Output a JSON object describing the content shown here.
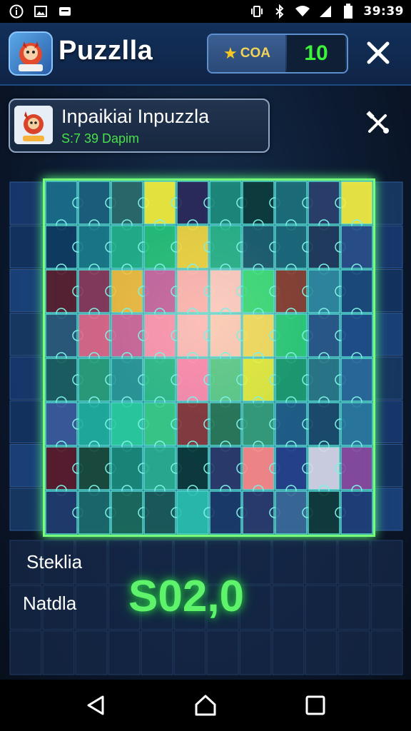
{
  "status_bar": {
    "time": "39:39",
    "left_icons": [
      "info-icon",
      "image-icon",
      "message-icon"
    ],
    "right_icons": [
      "vibrate-icon",
      "bluetooth-icon",
      "wifi-icon",
      "signal-icon",
      "battery-icon"
    ]
  },
  "header": {
    "app_title": "Puzzlla",
    "coins_label": "COA",
    "coins_value": "10",
    "close_icon": "close-icon"
  },
  "puzzle_card": {
    "title": "Inpaikiai Inpuzzla",
    "subtitle": "S:7 39  Dapim",
    "tools_icon": "tools-icon"
  },
  "board": {
    "cols": 10,
    "rows": 8,
    "tiles": [
      [
        "#1a6d8a",
        "#1a5f7a",
        "#2a6a6a",
        "#f5f03a",
        "#2b2a5a",
        "#1e8a7a",
        "#0d3a3a",
        "#1c6f7a",
        "#2a3f6a",
        "#f5ee40"
      ],
      [
        "#0f3a5f",
        "#1a7a8a",
        "#22b38a",
        "#27c37a",
        "#f0d640",
        "#2ab68a",
        "#1c5f6f",
        "#1c6a7a",
        "#203a5a",
        "#2a4f8a"
      ],
      [
        "#5a2030",
        "#8a3a5a",
        "#f2c040",
        "#c86aa0",
        "#ffb8b0",
        "#ffcfc0",
        "#40e07a",
        "#8a4030",
        "#2f8aa0",
        "#1b4a7a"
      ],
      [
        "#2a5a7a",
        "#e06a8a",
        "#d06a9a",
        "#ff9ab0",
        "#ffc0b8",
        "#ffd0b8",
        "#f5e060",
        "#2fd07a",
        "#2a5a8a",
        "#1f4f8a"
      ],
      [
        "#1a5f5f",
        "#2aa07a",
        "#2a9a9a",
        "#30c08a",
        "#ff90b0",
        "#60d08a",
        "#e6f040",
        "#1ca070",
        "#2a7a8a",
        "#2a6a9a"
      ],
      [
        "#3a5a9a",
        "#20b0a0",
        "#2ad0a0",
        "#3ad08a",
        "#8a3a3a",
        "#2a7a5a",
        "#36a07a",
        "#20608a",
        "#1a4a6a",
        "#2a7aa0"
      ],
      [
        "#5a1a2a",
        "#1a4a3a",
        "#1a8a7a",
        "#2ab090",
        "#0a3a3a",
        "#2a3a6a",
        "#ff8a8a",
        "#24408a",
        "#d8d8e8",
        "#8a4aa0"
      ],
      [
        "#1f3a6a",
        "#1a6a6a",
        "#1a6a5a",
        "#1a5a5a",
        "#2ac0b0",
        "#1a3a6a",
        "#2a3a6a",
        "#3a6a9a",
        "#103a3a",
        "#1f3f7a"
      ]
    ]
  },
  "stats": {
    "label_1": "Steklia",
    "label_2": "Natdla",
    "score": "S02,0"
  },
  "navbar": {
    "back_icon": "back-triangle-icon",
    "home_icon": "home-icon",
    "recents_icon": "recents-square-icon"
  }
}
